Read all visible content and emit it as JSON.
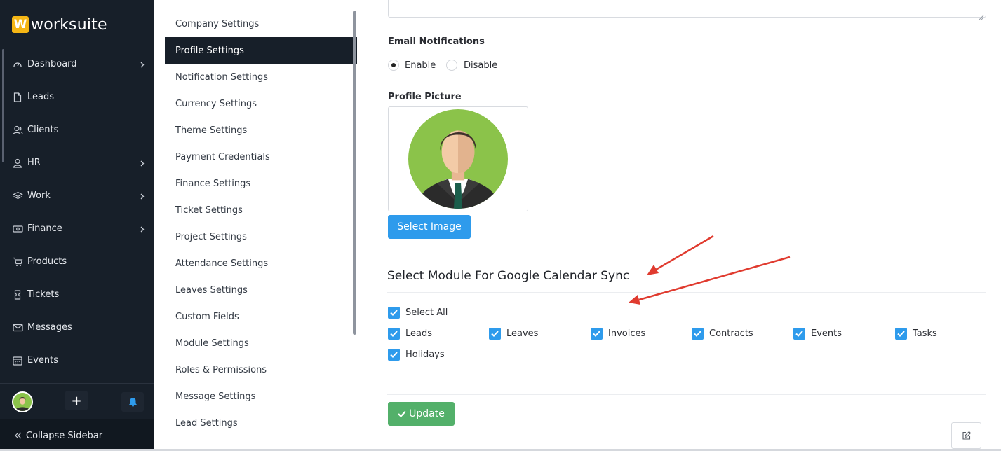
{
  "brand": {
    "logo_letter": "W",
    "name": "worksuite"
  },
  "sidebar": {
    "items": [
      {
        "label": "Dashboard",
        "icon": "dashboard-icon",
        "has_submenu": true
      },
      {
        "label": "Leads",
        "icon": "file-icon",
        "has_submenu": false
      },
      {
        "label": "Clients",
        "icon": "users-icon",
        "has_submenu": false
      },
      {
        "label": "HR",
        "icon": "user-icon",
        "has_submenu": true
      },
      {
        "label": "Work",
        "icon": "layers-icon",
        "has_submenu": true
      },
      {
        "label": "Finance",
        "icon": "money-icon",
        "has_submenu": true
      },
      {
        "label": "Products",
        "icon": "cart-icon",
        "has_submenu": false
      },
      {
        "label": "Tickets",
        "icon": "ticket-icon",
        "has_submenu": false
      },
      {
        "label": "Messages",
        "icon": "envelope-icon",
        "has_submenu": false
      },
      {
        "label": "Events",
        "icon": "calendar-icon",
        "has_submenu": false
      }
    ],
    "add_symbol": "+",
    "collapse_label": "Collapse Sidebar"
  },
  "settings_menu": {
    "items": [
      {
        "label": "Company Settings",
        "active": false
      },
      {
        "label": "Profile Settings",
        "active": true
      },
      {
        "label": "Notification Settings",
        "active": false
      },
      {
        "label": "Currency Settings",
        "active": false
      },
      {
        "label": "Theme Settings",
        "active": false
      },
      {
        "label": "Payment Credentials",
        "active": false
      },
      {
        "label": "Finance Settings",
        "active": false
      },
      {
        "label": "Ticket Settings",
        "active": false
      },
      {
        "label": "Project Settings",
        "active": false
      },
      {
        "label": "Attendance Settings",
        "active": false
      },
      {
        "label": "Leaves Settings",
        "active": false
      },
      {
        "label": "Custom Fields",
        "active": false
      },
      {
        "label": "Module Settings",
        "active": false
      },
      {
        "label": "Roles & Permissions",
        "active": false
      },
      {
        "label": "Message Settings",
        "active": false
      },
      {
        "label": "Lead Settings",
        "active": false
      }
    ]
  },
  "form": {
    "email_notifications": {
      "label": "Email Notifications",
      "options": [
        {
          "label": "Enable",
          "selected": true
        },
        {
          "label": "Disable",
          "selected": false
        }
      ]
    },
    "profile_picture": {
      "label": "Profile Picture",
      "button_label": "Select Image"
    },
    "calendar_sync": {
      "title": "Select Module For Google Calendar Sync",
      "select_all": {
        "label": "Select All",
        "checked": true
      },
      "modules": [
        {
          "label": "Leads",
          "checked": true
        },
        {
          "label": "Leaves",
          "checked": true
        },
        {
          "label": "Invoices",
          "checked": true
        },
        {
          "label": "Contracts",
          "checked": true
        },
        {
          "label": "Events",
          "checked": true
        },
        {
          "label": "Tasks",
          "checked": true
        },
        {
          "label": "Holidays",
          "checked": true
        }
      ]
    },
    "update_label": "Update"
  },
  "colors": {
    "sidebar_bg": "#171f29",
    "primary": "#2e9bec",
    "success": "#53b06a",
    "annotation_arrow": "#e03b2f",
    "logo": "#f5b615"
  }
}
